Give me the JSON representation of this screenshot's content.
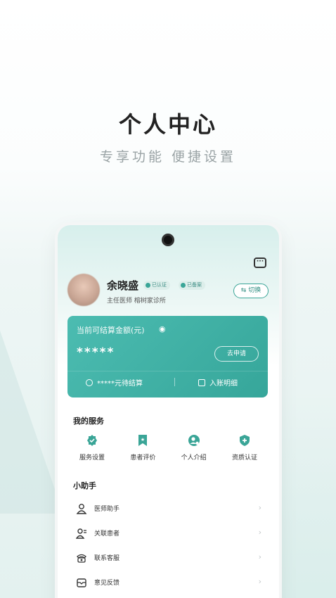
{
  "promo": {
    "headline": "个人中心",
    "subline": "专享功能 便捷设置"
  },
  "profile": {
    "name": "余晓盛",
    "badge_certified": "已认证",
    "badge_filed": "已备案",
    "title_line": "主任医师 榕树家诊所",
    "switch_label": "⇆ 切换"
  },
  "balance": {
    "label": "当前可结算金额(元)",
    "amount_masked": "*****",
    "apply_label": "去申请",
    "pending_text": "*****元待结算",
    "detail_text": "入账明细"
  },
  "services": {
    "title": "我的服务",
    "items": [
      {
        "label": "服务设置",
        "icon": "settings-badge-icon"
      },
      {
        "label": "患者评价",
        "icon": "bookmark-star-icon"
      },
      {
        "label": "个人介绍",
        "icon": "profile-icon"
      },
      {
        "label": "资质认证",
        "icon": "shield-plus-icon"
      }
    ]
  },
  "helper": {
    "title": "小助手",
    "items": [
      {
        "label": "医师助手",
        "icon": "user-outline-icon"
      },
      {
        "label": "关联患者",
        "icon": "users-link-icon"
      },
      {
        "label": "联系客服",
        "icon": "phone-icon"
      },
      {
        "label": "意见反馈",
        "icon": "envelope-icon"
      }
    ]
  },
  "colors": {
    "accent": "#3aa597",
    "card_gradient_start": "#4cbcb1",
    "card_gradient_end": "#36a69a"
  }
}
